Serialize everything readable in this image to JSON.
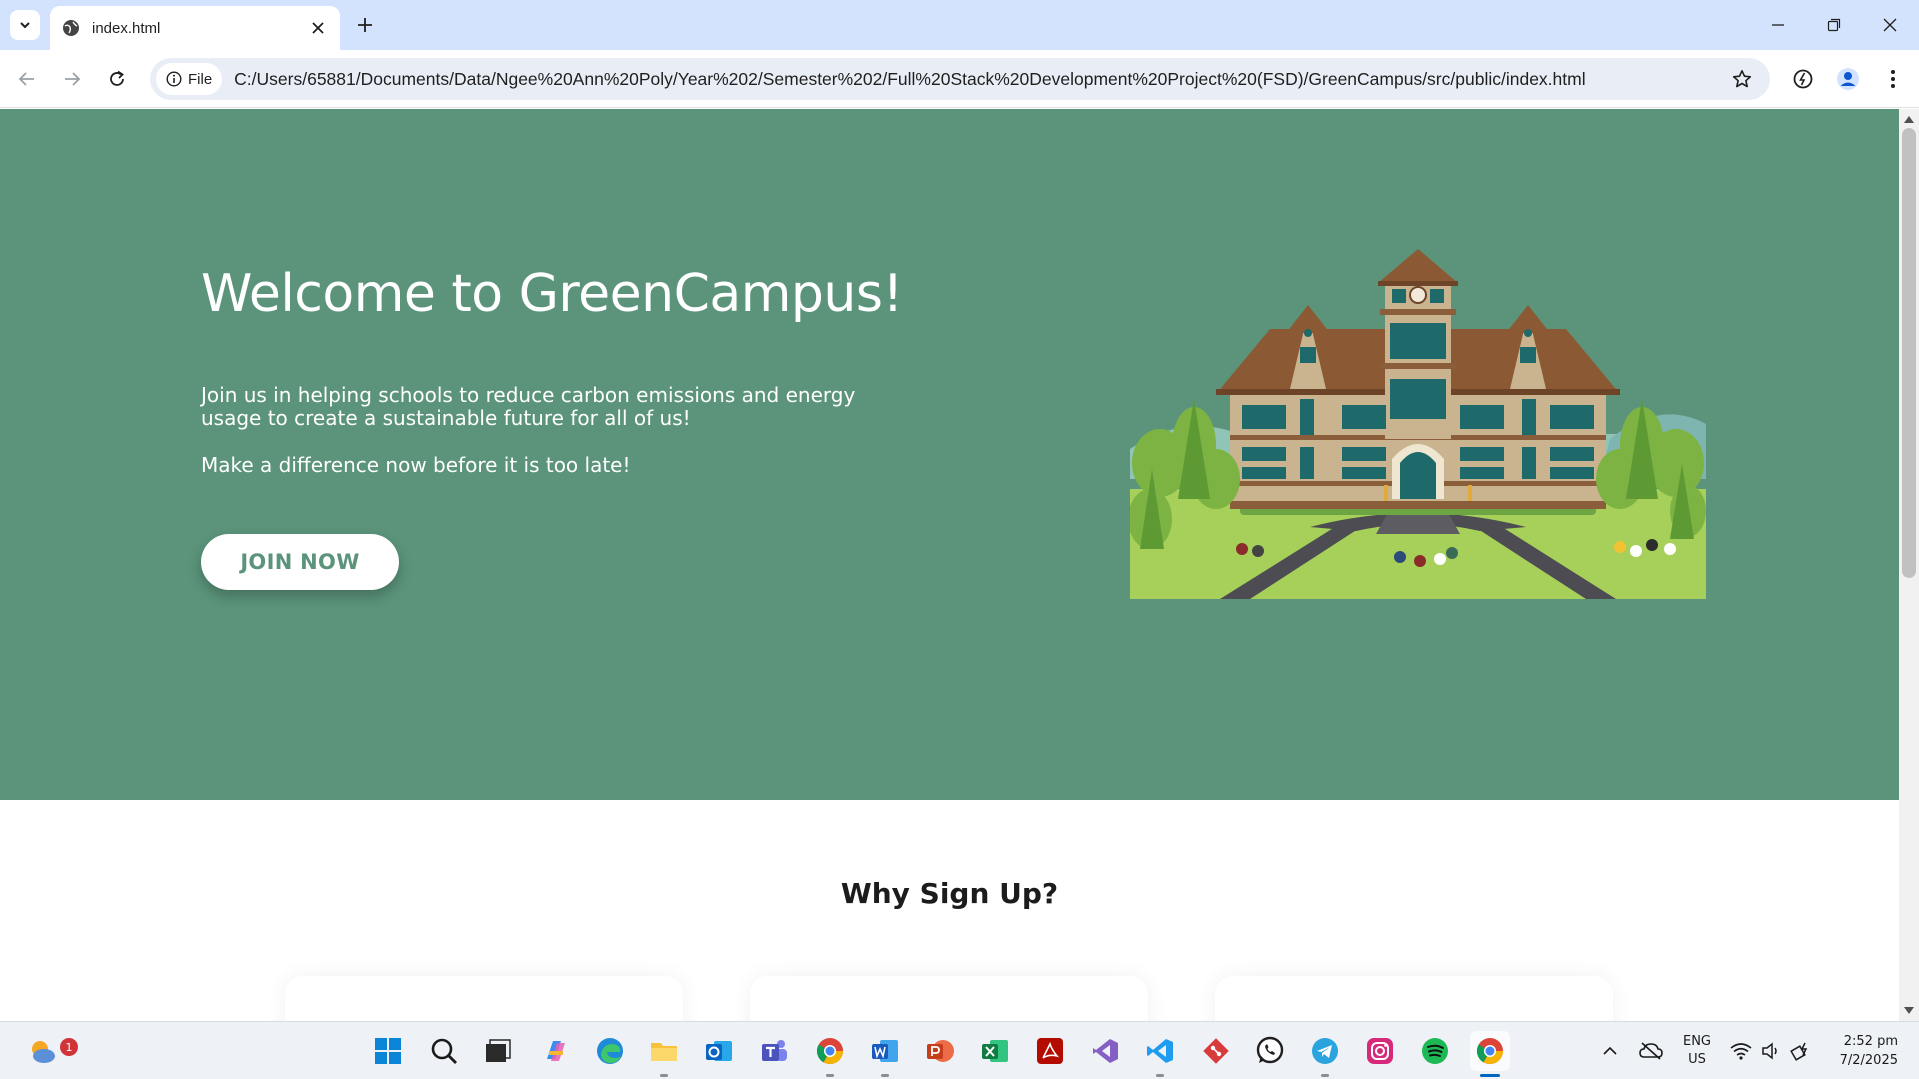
{
  "browser": {
    "tab_title": "index.html",
    "chip_label": "File",
    "url": "C:/Users/65881/Documents/Data/Ngee%20Ann%20Poly/Year%202/Semester%202/Full%20Stack%20Development%20Project%20(FSD)/GreenCampus/src/public/index.html"
  },
  "hero": {
    "title": "Welcome to GreenCampus!",
    "paragraph": "Join us in helping schools to reduce carbon emissions and energy usage to create a sustainable future for all of us!",
    "cta_text": "Make a difference now before it is too late!",
    "button_label": "JOIN NOW"
  },
  "why": {
    "title": "Why Sign Up?"
  },
  "taskbar": {
    "weather_badge": "1",
    "lang_primary": "ENG",
    "lang_secondary": "US",
    "time": "2:52 pm",
    "date": "7/2/2025"
  },
  "colors": {
    "hero_bg": "#5b947b",
    "accent": "#5b947b",
    "chrome_tabbar": "#d3e3fd"
  }
}
